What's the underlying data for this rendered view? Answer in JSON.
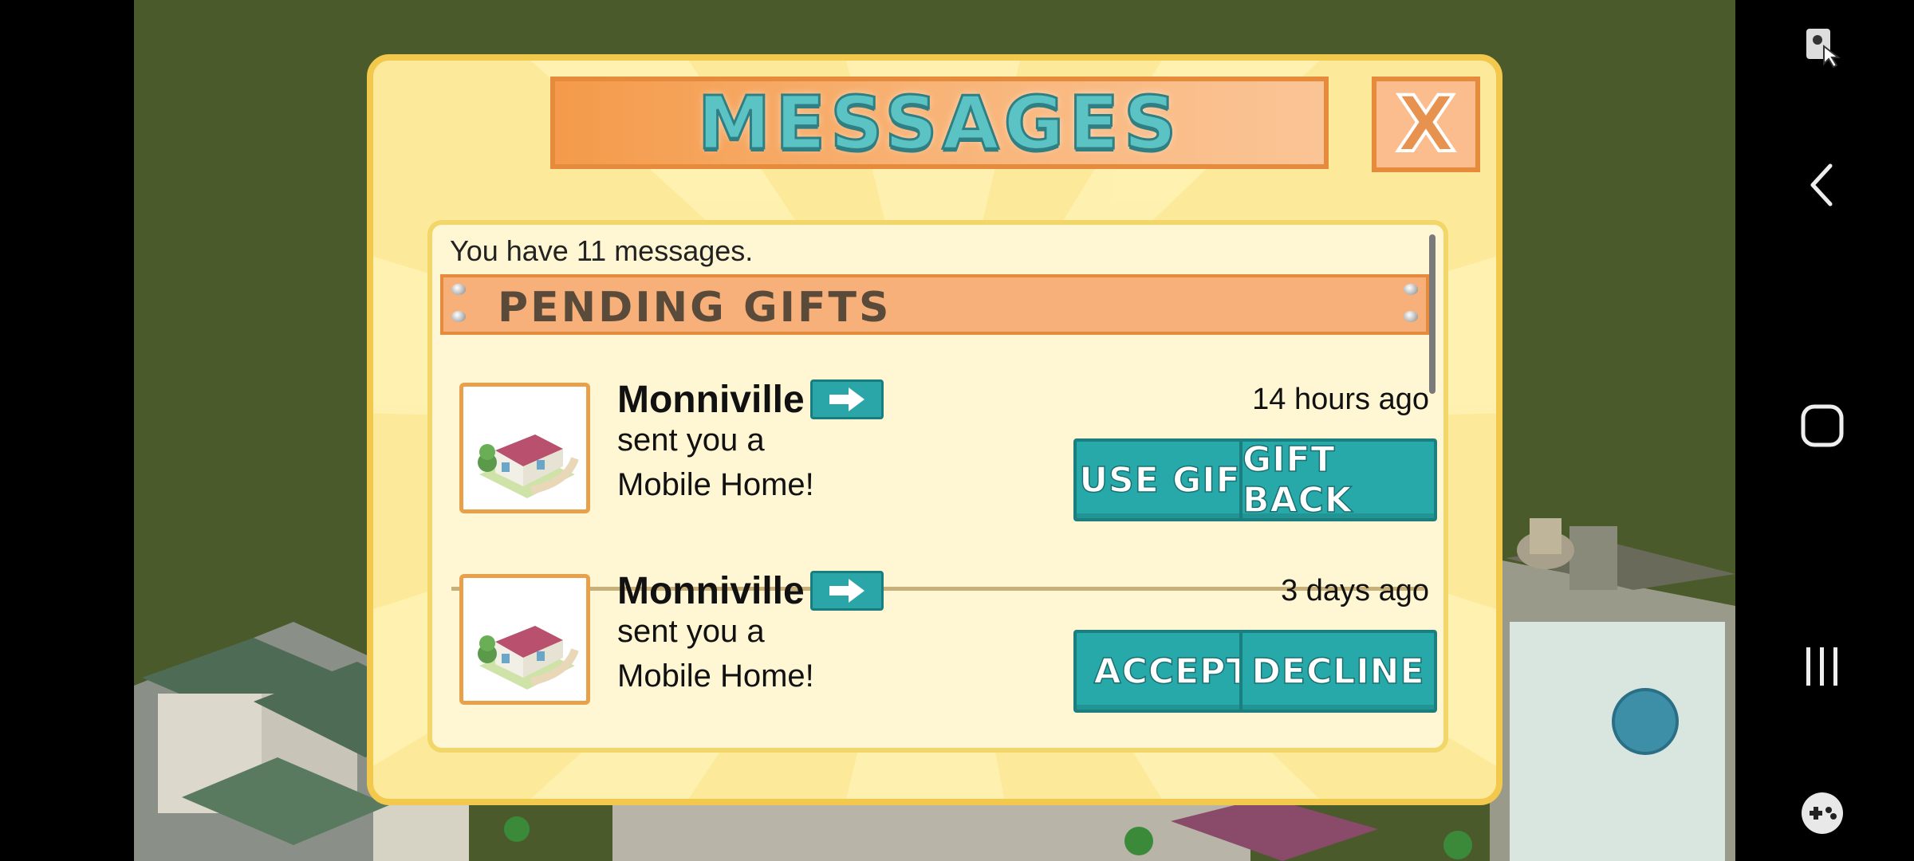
{
  "dialog": {
    "title": "MESSAGES",
    "close_label": "X",
    "message_count_text": "You have 11 messages.",
    "section_title": "PENDING GIFTS"
  },
  "messages": [
    {
      "sender": "Monniville",
      "line1": "sent you a",
      "line2": "Mobile Home!",
      "time": "14 hours ago",
      "primary_action": "USE GIFT",
      "secondary_action": "GIFT BACK"
    },
    {
      "sender": "Monniville",
      "line1": "sent you a",
      "line2": "Mobile Home!",
      "time": "3 days ago",
      "primary_action": "ACCEPT",
      "secondary_action": "DECLINE"
    }
  ],
  "system_nav": {
    "icons": [
      "accessibility-icon",
      "back-icon",
      "home-icon",
      "recents-icon",
      "game-tools-icon"
    ]
  },
  "colors": {
    "dialog_bg": "#fde99a",
    "banner_orange": "#f49a4a",
    "button_teal": "#27a9a9",
    "grass": "#4a5a2a"
  }
}
